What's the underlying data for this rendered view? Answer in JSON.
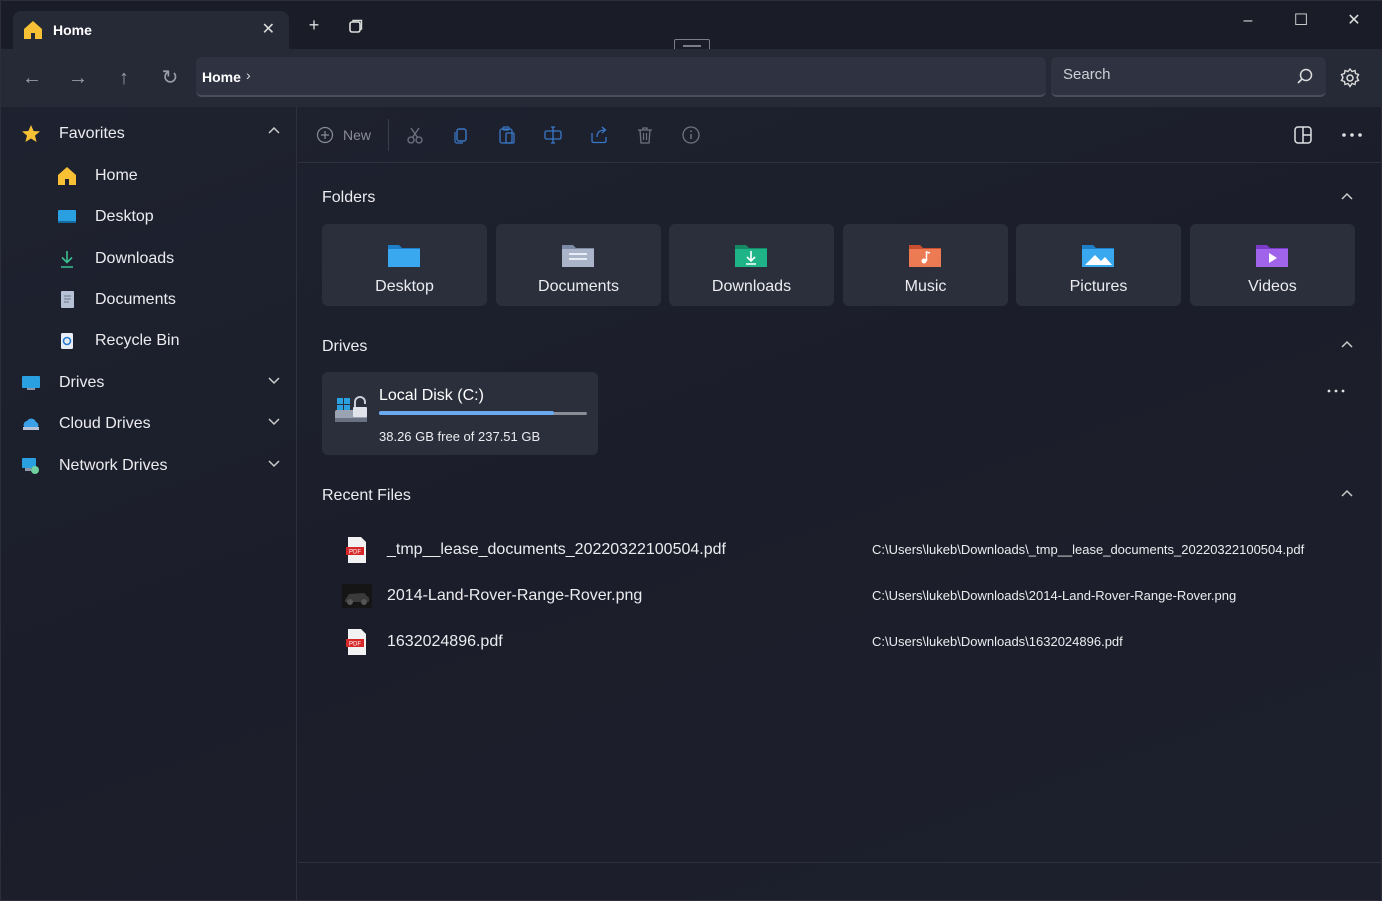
{
  "tab": {
    "title": "Home",
    "icon": "home-icon"
  },
  "titlebar": {
    "new_tab": "+",
    "close": "✕"
  },
  "address": {
    "crumb": "Home"
  },
  "search": {
    "placeholder": "Search"
  },
  "sidebar": {
    "favorites": "Favorites",
    "items": [
      {
        "label": "Home",
        "icon": "home-icon"
      },
      {
        "label": "Desktop",
        "icon": "desktop-icon"
      },
      {
        "label": "Downloads",
        "icon": "downloads-icon"
      },
      {
        "label": "Documents",
        "icon": "documents-icon"
      },
      {
        "label": "Recycle Bin",
        "icon": "recycle-bin-icon"
      }
    ],
    "drives": "Drives",
    "cloud_drives": "Cloud Drives",
    "network_drives": "Network Drives"
  },
  "toolbar": {
    "new_label": "New"
  },
  "sections": {
    "folders": "Folders",
    "drives": "Drives",
    "recent": "Recent Files"
  },
  "folders": [
    {
      "label": "Desktop",
      "color": "#3aa0e8"
    },
    {
      "label": "Documents",
      "color": "#9aa7bf"
    },
    {
      "label": "Downloads",
      "color": "#1fae80"
    },
    {
      "label": "Music",
      "color": "#e8704a"
    },
    {
      "label": "Pictures",
      "color": "#3aa0e8"
    },
    {
      "label": "Videos",
      "color": "#9a5ce0"
    }
  ],
  "drive": {
    "name": "Local Disk (C:)",
    "free": "38.26 GB free of 237.51 GB",
    "used_fraction": 0.84
  },
  "recent_files": [
    {
      "name": "_tmp__lease_documents_20220322100504.pdf",
      "path": "C:\\Users\\lukeb\\Downloads\\_tmp__lease_documents_20220322100504.pdf",
      "type": "pdf"
    },
    {
      "name": "2014-Land-Rover-Range-Rover.png",
      "path": "C:\\Users\\lukeb\\Downloads\\2014-Land-Rover-Range-Rover.png",
      "type": "image"
    },
    {
      "name": "1632024896.pdf",
      "path": "C:\\Users\\lukeb\\Downloads\\1632024896.pdf",
      "type": "pdf"
    }
  ],
  "colors": {
    "accent": "#6aa9ef",
    "home_yellow": "#f7c035",
    "star": "#f7c035"
  }
}
